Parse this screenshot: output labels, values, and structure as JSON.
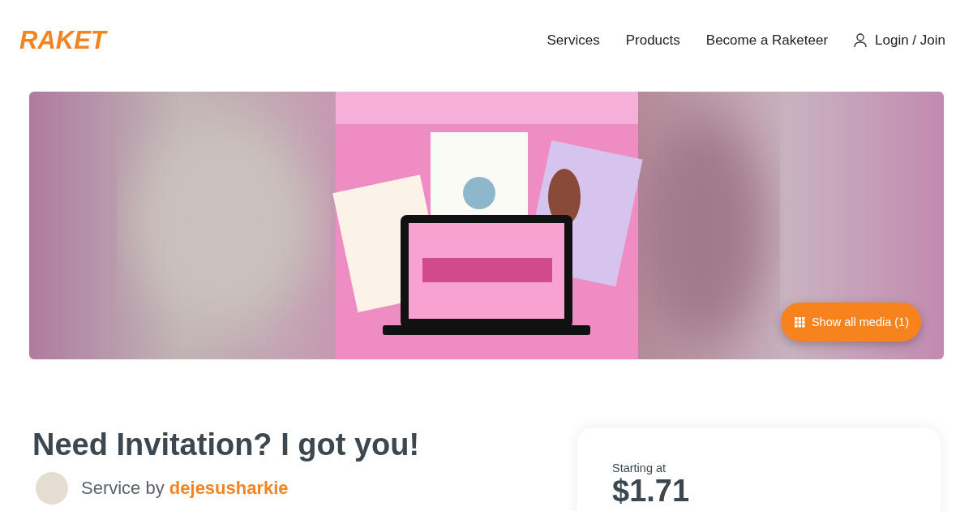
{
  "header": {
    "logo": "RAKET",
    "nav": [
      {
        "label": "Services",
        "kind": "link"
      },
      {
        "label": "Products",
        "kind": "link"
      },
      {
        "label": "Become a Raketeer",
        "kind": "link"
      },
      {
        "label": "Login / Join",
        "kind": "account"
      }
    ]
  },
  "gallery": {
    "button": "Show all media (1)"
  },
  "service": {
    "title": "Need Invitation? I got you!",
    "by_label": "Service by",
    "seller": "dejesusharkie"
  },
  "pricing": {
    "label": "Starting at",
    "price": "$1.71"
  }
}
